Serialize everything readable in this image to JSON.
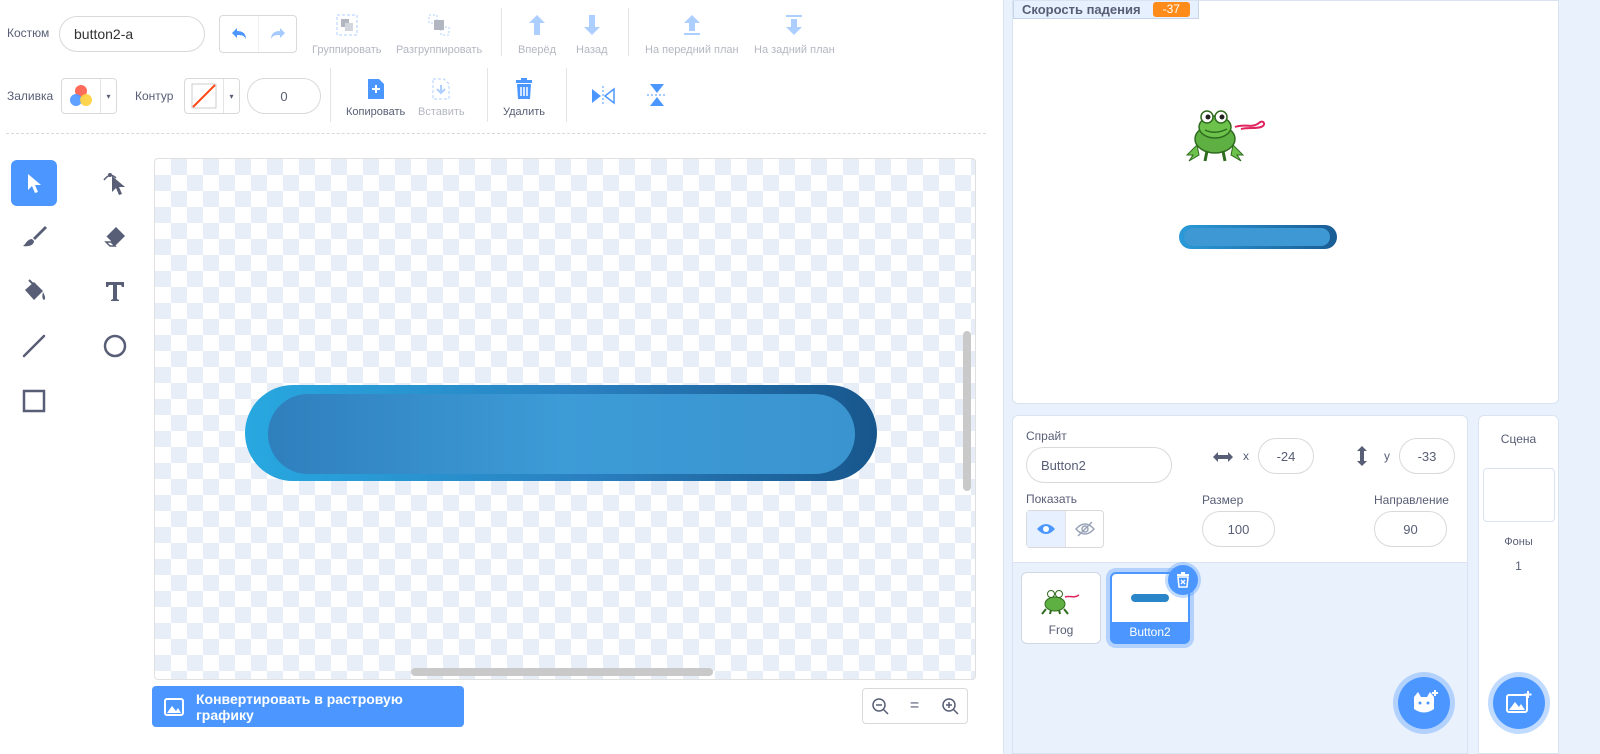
{
  "costume": {
    "label": "Костюм",
    "name": "button2-a"
  },
  "toolbar_top": {
    "group": "Группировать",
    "ungroup": "Разгруппировать",
    "forward": "Вперёд",
    "backward": "Назад",
    "front": "На передний план",
    "back": "На задний план"
  },
  "toolbar_second": {
    "fill_label": "Заливка",
    "outline_label": "Контур",
    "outline_width": "0",
    "copy": "Копировать",
    "paste": "Вставить",
    "delete": "Удалить"
  },
  "convert_button": "Конвертировать в растровую графику",
  "zoom": {
    "reset": "="
  },
  "stage_monitor": {
    "label": "Скорость падения",
    "value": "-37"
  },
  "sprite_info": {
    "sprite_label": "Спрайт",
    "sprite_name": "Button2",
    "x_label": "x",
    "x_value": "-24",
    "y_label": "y",
    "y_value": "-33",
    "show_label": "Показать",
    "size_label": "Размер",
    "size_value": "100",
    "direction_label": "Направление",
    "direction_value": "90"
  },
  "sprites": [
    {
      "name": "Frog",
      "selected": false
    },
    {
      "name": "Button2",
      "selected": true
    }
  ],
  "scene": {
    "title": "Сцена",
    "backdrops_label": "Фоны",
    "backdrops_count": "1"
  },
  "colors": {
    "accent": "#4c97ff",
    "monitor_value": "#ff8c1a",
    "shape_fill": "#3d98d3",
    "shape_dark": "#1a5c94"
  }
}
